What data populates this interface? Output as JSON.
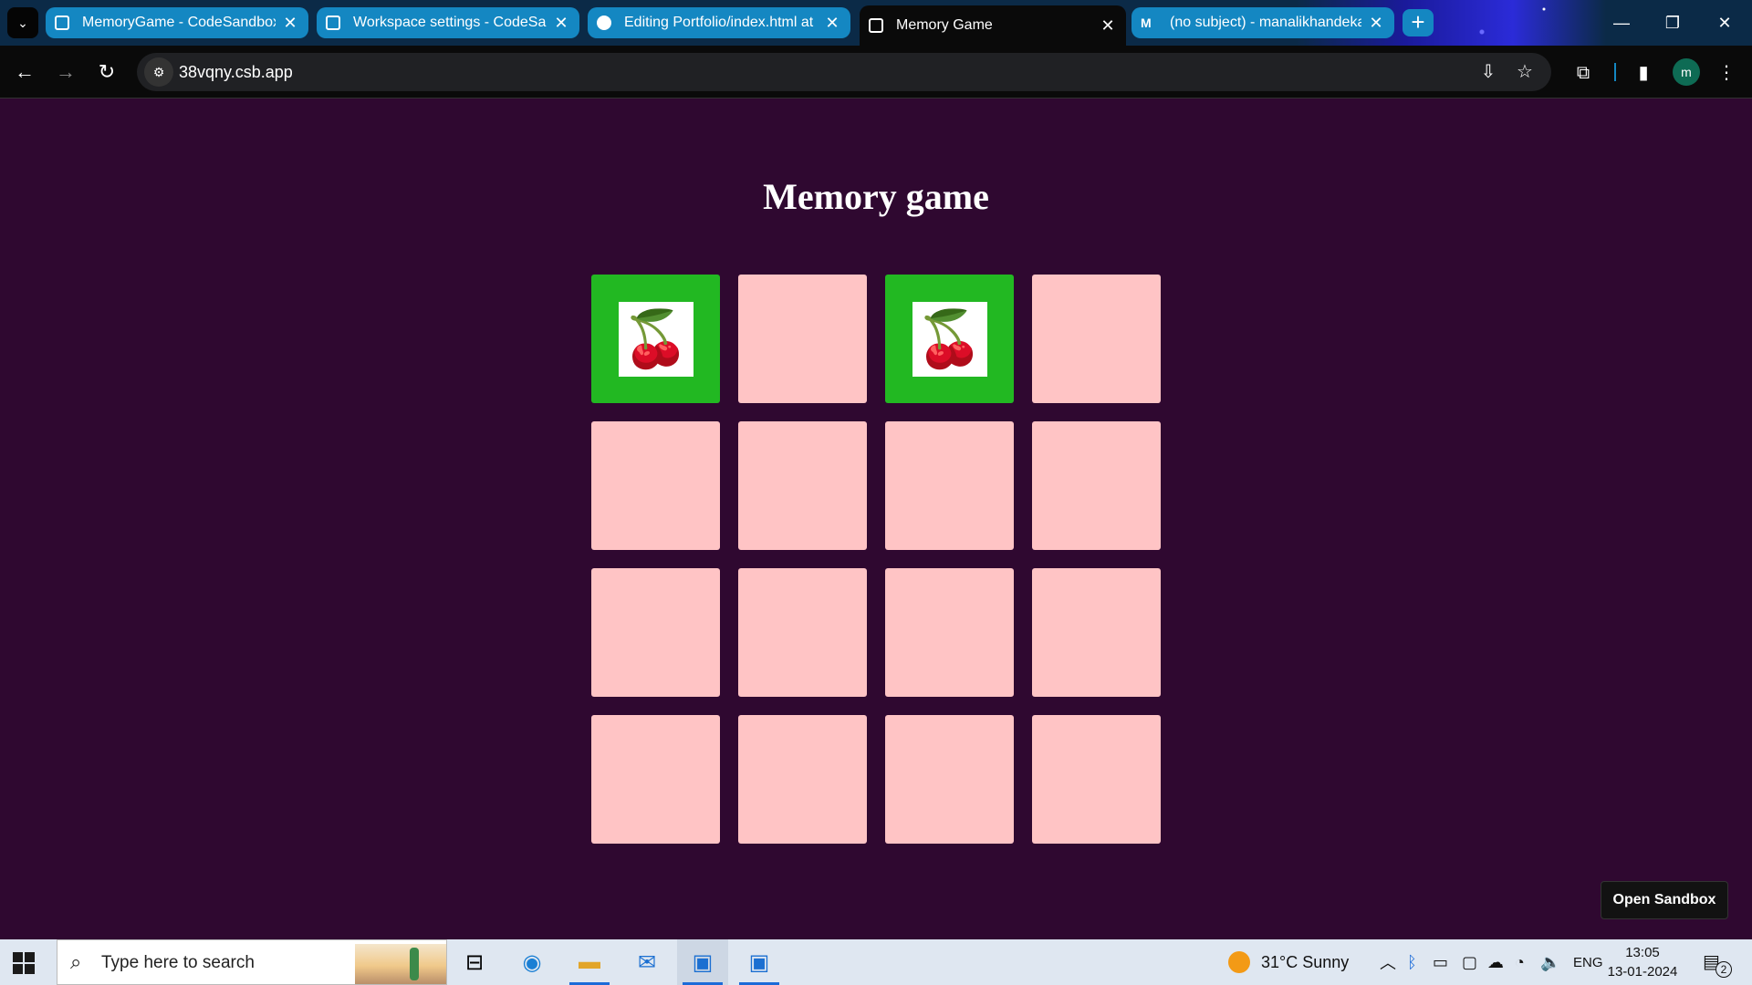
{
  "browser": {
    "tabs": [
      {
        "title": "MemoryGame - CodeSandbox",
        "favicon": "codesandbox-icon",
        "active": false
      },
      {
        "title": "Workspace settings - CodeSand",
        "favicon": "codesandbox-icon",
        "active": false
      },
      {
        "title": "Editing Portfolio/index.html at m",
        "favicon": "github-icon",
        "active": false
      },
      {
        "title": "Memory Game",
        "favicon": "codesandbox-icon",
        "active": true
      },
      {
        "title": "(no subject) - manalikhandekar",
        "favicon": "gmail-icon",
        "active": false
      }
    ],
    "url": "38vqny.csb.app",
    "profile_initial": "m"
  },
  "page": {
    "title": "Memory game",
    "cards": [
      {
        "state": "matched",
        "icon": "cherry-icon",
        "symbol": "🍒"
      },
      {
        "state": "hidden"
      },
      {
        "state": "matched",
        "icon": "cherry-icon",
        "symbol": "🍒"
      },
      {
        "state": "hidden"
      },
      {
        "state": "hidden"
      },
      {
        "state": "hidden"
      },
      {
        "state": "hidden"
      },
      {
        "state": "hidden"
      },
      {
        "state": "hidden"
      },
      {
        "state": "hidden"
      },
      {
        "state": "hidden"
      },
      {
        "state": "hidden"
      },
      {
        "state": "hidden"
      },
      {
        "state": "hidden"
      },
      {
        "state": "hidden"
      },
      {
        "state": "hidden"
      }
    ],
    "open_sandbox_label": "Open Sandbox",
    "colors": {
      "background": "#2f0830",
      "card_hidden": "#ffc4c5",
      "card_matched": "#22b822"
    }
  },
  "taskbar": {
    "search_placeholder": "Type here to search",
    "weather": "31°C  Sunny",
    "language": "ENG",
    "time": "13:05",
    "date": "13-01-2024",
    "notifications": "2"
  }
}
